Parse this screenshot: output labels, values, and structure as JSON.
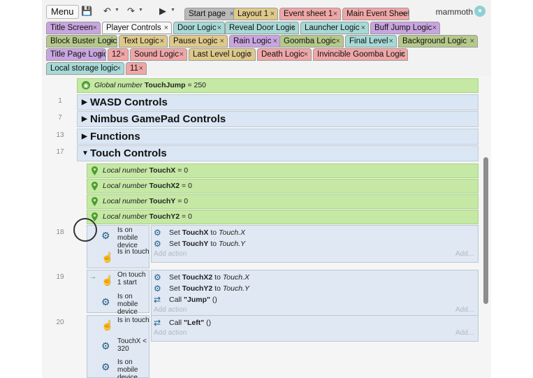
{
  "toolbar": {
    "menu_label": "Menu",
    "user_name": "mammoth"
  },
  "tabs": [
    {
      "label": "Start page",
      "color": "#b9b9b9"
    },
    {
      "label": "Layout 1",
      "color": "#dfc98a"
    },
    {
      "label": "Event sheet 1",
      "color": "#f0a6a6"
    },
    {
      "label": "Main Event Sheet",
      "color": "#f0a6a6"
    },
    {
      "label": "Title Screen",
      "color": "#c9a5e0"
    },
    {
      "label": "Player Controls",
      "color": "#f7f7f7"
    },
    {
      "label": "Door Logic",
      "color": "#a7d9d6"
    },
    {
      "label": "Reveal Door Logic",
      "color": "#a7d9d6"
    },
    {
      "label": "Launcher Logic",
      "color": "#a7d9d6"
    },
    {
      "label": "Buff Jump Logic",
      "color": "#c9a5e0"
    },
    {
      "label": "Block Buster Logic",
      "color": "#b5c98a"
    },
    {
      "label": "Text Logic",
      "color": "#dfc98a"
    },
    {
      "label": "Pause Logic",
      "color": "#dfc98a"
    },
    {
      "label": "Rain Logic",
      "color": "#c9a5e0"
    },
    {
      "label": "Goomba Logic",
      "color": "#b5c98a"
    },
    {
      "label": "Final Level",
      "color": "#a7d9d6"
    },
    {
      "label": "Background Logic",
      "color": "#b5c98a"
    },
    {
      "label": "Title Page Logic",
      "color": "#c9a5e0"
    },
    {
      "label": "12",
      "color": "#f0a6a6"
    },
    {
      "label": "Sound Logic",
      "color": "#f0a6a6"
    },
    {
      "label": "Last Level Logic",
      "color": "#dfc98a"
    },
    {
      "label": "Death Logic",
      "color": "#f0a6a6"
    },
    {
      "label": "Invincible Goomba Logic",
      "color": "#f0a6a6"
    },
    {
      "label": "Local storage logic",
      "color": "#a7d9d6"
    },
    {
      "label": "11",
      "color": "#f0a6a6"
    }
  ],
  "close_glyph": "×",
  "sheet": {
    "global_var": {
      "prefix": "Global number",
      "name": "TouchJump",
      "eq": "= 250"
    },
    "groups": [
      {
        "line": "1",
        "title": "WASD Controls",
        "tri": "▶"
      },
      {
        "line": "7",
        "title": "Nimbus GamePad Controls",
        "tri": "▶"
      },
      {
        "line": "13",
        "title": "Functions",
        "tri": "▶"
      },
      {
        "line": "17",
        "title": "Touch Controls",
        "tri": "▼"
      }
    ],
    "local_vars": [
      {
        "prefix": "Local number",
        "name": "TouchX",
        "eq": "= 0"
      },
      {
        "prefix": "Local number",
        "name": "TouchX2",
        "eq": "= 0"
      },
      {
        "prefix": "Local number",
        "name": "TouchY",
        "eq": "= 0"
      },
      {
        "prefix": "Local number",
        "name": "TouchY2",
        "eq": "= 0"
      }
    ],
    "events": [
      {
        "line": "18",
        "conditions": [
          "Is on mobile device",
          "Is in touch"
        ],
        "actions": [
          {
            "verb": "Set",
            "target": "TouchX",
            "to": "to",
            "value": "Touch.X"
          },
          {
            "verb": "Set",
            "target": "TouchY",
            "to": "to",
            "value": "Touch.Y"
          }
        ]
      },
      {
        "line": "19",
        "conditions": [
          "On touch 1 start",
          "Is on mobile device"
        ],
        "actions": [
          {
            "verb": "Set",
            "target": "TouchX2",
            "to": "to",
            "value": "Touch.X"
          },
          {
            "verb": "Set",
            "target": "TouchY2",
            "to": "to",
            "value": "Touch.Y"
          },
          {
            "verb": "Call",
            "target": "\"Jump\"",
            "to": "",
            "value": "()"
          }
        ]
      },
      {
        "line": "20",
        "conditions": [
          "Is in touch",
          "TouchX < 320",
          "Is on mobile device"
        ],
        "actions": [
          {
            "verb": "Call",
            "target": "\"Left\"",
            "to": "",
            "value": "()"
          }
        ]
      }
    ],
    "add_action_label": "Add action",
    "add_label": "Add..."
  }
}
